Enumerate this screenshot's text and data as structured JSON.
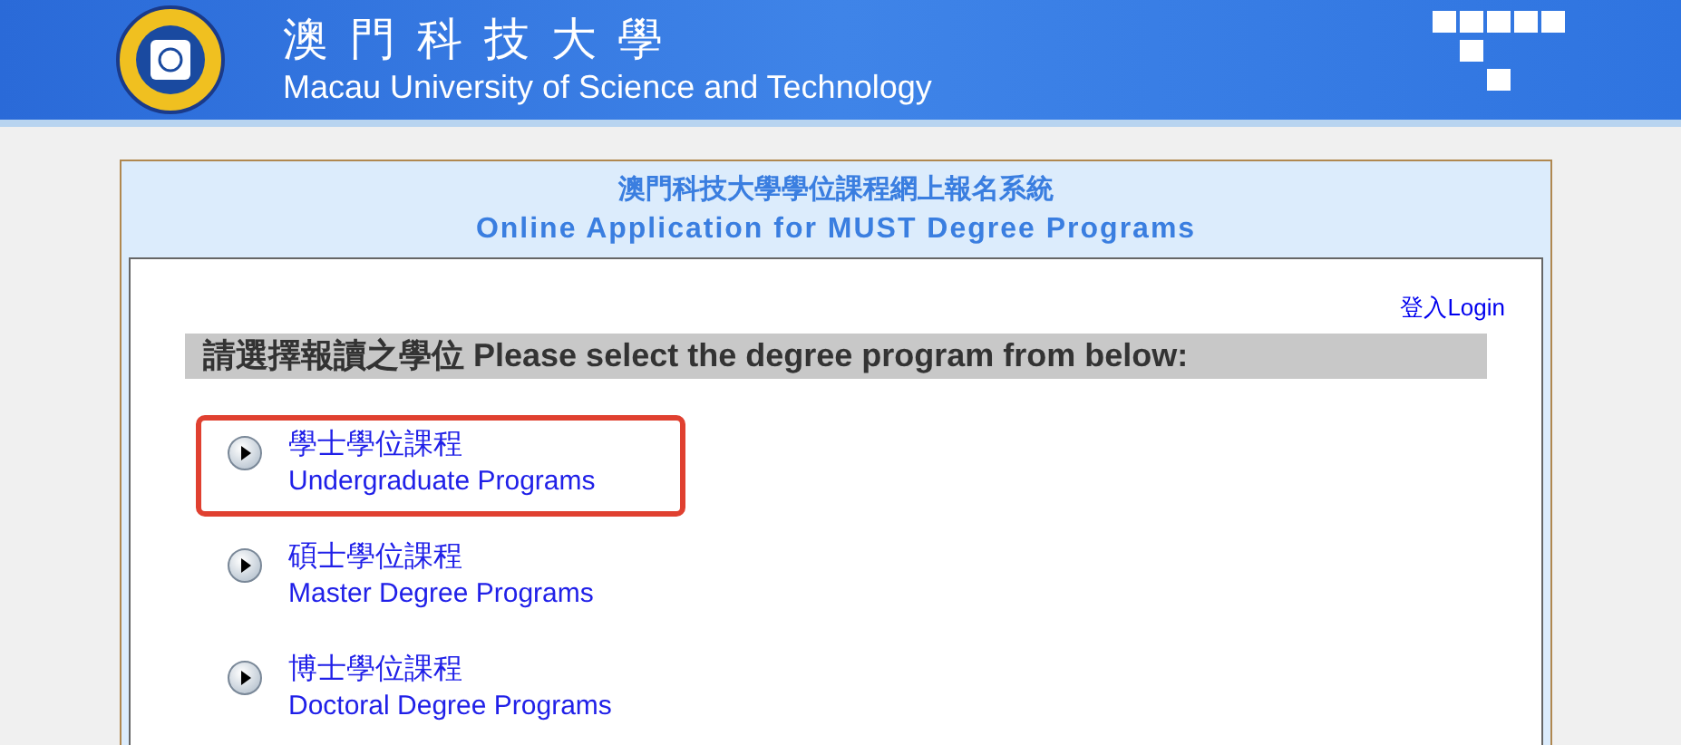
{
  "header": {
    "title_zh": "澳 門 科 技 大 學",
    "title_en": "Macau University of Science and Technology"
  },
  "panel": {
    "title_zh": "澳門科技大學學位課程網上報名系統",
    "title_en": "Online Application for MUST Degree Programs"
  },
  "login_link": "登入Login",
  "section_heading": "請選擇報讀之學位 Please select the degree program from below:",
  "programs": [
    {
      "name_zh": "學士學位課程",
      "name_en": "Undergraduate Programs",
      "highlighted": true
    },
    {
      "name_zh": "碩士學位課程",
      "name_en": "Master Degree Programs",
      "highlighted": false
    },
    {
      "name_zh": "博士學位課程",
      "name_en": "Doctoral Degree Programs",
      "highlighted": false
    }
  ]
}
